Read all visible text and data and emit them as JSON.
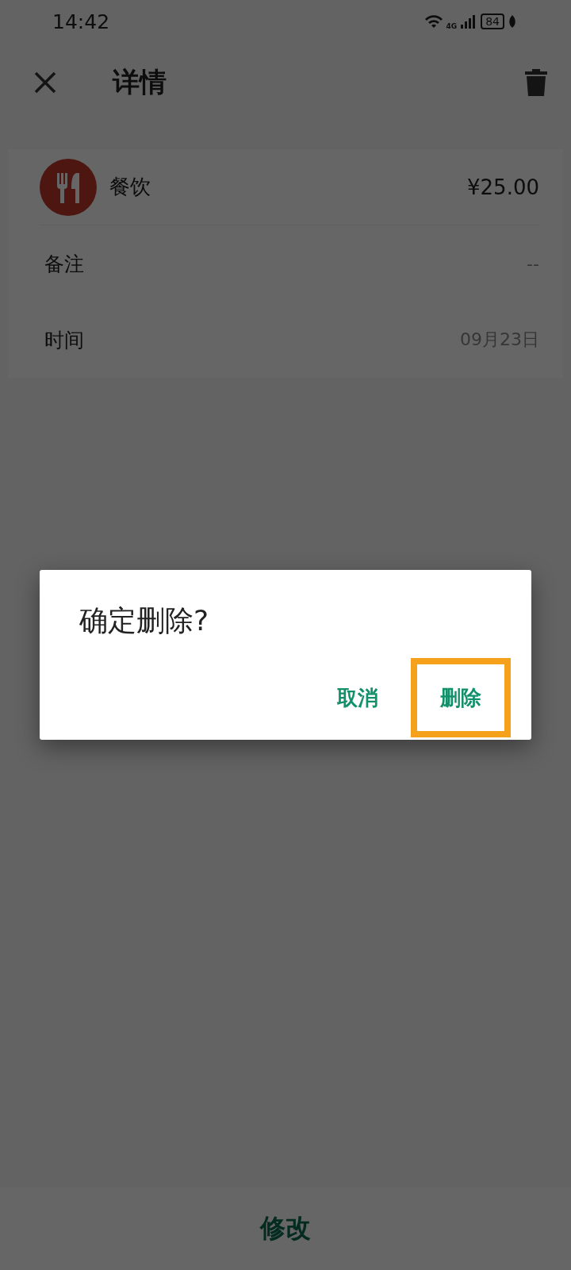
{
  "status_bar": {
    "time": "14:42",
    "network": "4G",
    "battery": "84"
  },
  "header": {
    "title": "详情"
  },
  "record": {
    "category": "餐饮",
    "amount": "¥25.00",
    "fields": [
      {
        "label": "备注",
        "value": "--"
      },
      {
        "label": "时间",
        "value": "09月23日"
      }
    ]
  },
  "bottom_bar": {
    "button": "修改"
  },
  "dialog": {
    "title": "确定删除?",
    "buttons": [
      {
        "label": "取消",
        "highlighted": false
      },
      {
        "label": "删除",
        "highlighted": true
      }
    ]
  }
}
